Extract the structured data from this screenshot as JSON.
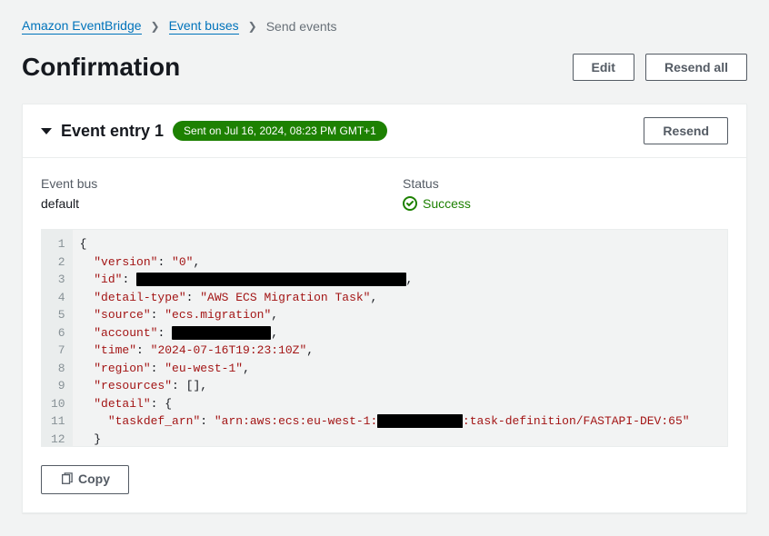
{
  "breadcrumb": {
    "root": "Amazon EventBridge",
    "buses": "Event buses",
    "current": "Send events"
  },
  "page": {
    "title": "Confirmation",
    "edit_label": "Edit",
    "resend_all_label": "Resend all"
  },
  "entry": {
    "title": "Event entry 1",
    "timestamp_badge": "Sent on Jul 16, 2024, 08:23 PM GMT+1",
    "resend_label": "Resend",
    "event_bus_label": "Event bus",
    "event_bus_value": "default",
    "status_label": "Status",
    "status_value": "Success",
    "copy_label": "Copy"
  },
  "code": {
    "version_key": "\"version\"",
    "version_val": "\"0\"",
    "id_key": "\"id\"",
    "id_val_redacted": "\"████████████████████████████████████\"",
    "detailtype_key": "\"detail-type\"",
    "detailtype_val": "\"AWS ECS Migration Task\"",
    "source_key": "\"source\"",
    "source_val": "\"ecs.migration\"",
    "account_key": "\"account\"",
    "account_val_redacted": "\"████████████\"",
    "time_key": "\"time\"",
    "time_val": "\"2024-07-16T19:23:10Z\"",
    "region_key": "\"region\"",
    "region_val": "\"eu-west-1\"",
    "resources_key": "\"resources\"",
    "detail_key": "\"detail\"",
    "taskdef_key": "\"taskdef_arn\"",
    "taskdef_val_pre": "\"arn:aws:ecs:eu-west-1:",
    "taskdef_val_mid_redacted": "████████████",
    "taskdef_val_post": ":task-definition/FASTAPI-DEV:65\""
  }
}
